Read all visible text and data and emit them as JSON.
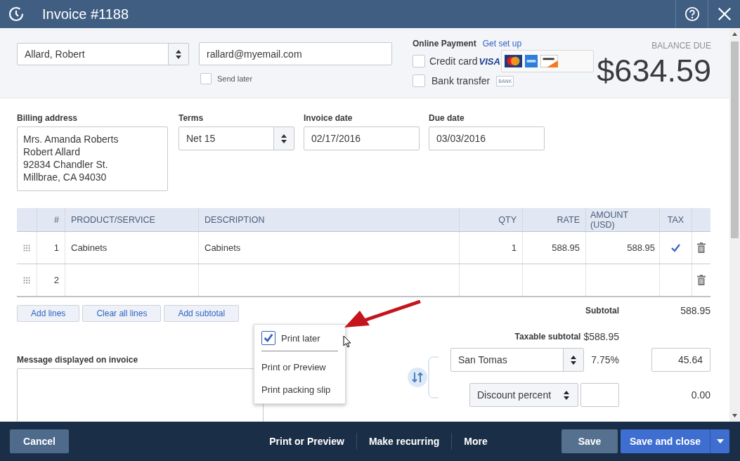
{
  "header": {
    "title": "Invoice #1188"
  },
  "customer": {
    "value": "Allard, Robert"
  },
  "email": {
    "value": "rallard@myemail.com"
  },
  "send_later": {
    "label": "Send later",
    "checked": false
  },
  "online_payment": {
    "title": "Online Payment",
    "link": "Get set up",
    "options": [
      {
        "kind": "card",
        "label": "Credit card",
        "checked": false,
        "badge": "VISA"
      },
      {
        "kind": "bank",
        "label": "Bank transfer",
        "checked": false,
        "badge": "BANK"
      }
    ]
  },
  "balance": {
    "label": "BALANCE DUE",
    "amount": "$634.59"
  },
  "billing_address": {
    "label": "Billing address",
    "lines": [
      "Mrs. Amanda Roberts",
      "Robert Allard",
      "92834 Chandler St.",
      "Millbrae, CA  94030"
    ]
  },
  "terms": {
    "label": "Terms",
    "value": "Net 15"
  },
  "invoice_date": {
    "label": "Invoice date",
    "value": "02/17/2016"
  },
  "due_date": {
    "label": "Due date",
    "value": "03/03/2016"
  },
  "table": {
    "columns": [
      "#",
      "PRODUCT/SERVICE",
      "DESCRIPTION",
      "QTY",
      "RATE",
      "AMOUNT (USD)",
      "TAX"
    ],
    "rows": [
      {
        "number": "1",
        "product": "Cabinets",
        "description": "Cabinets",
        "qty": "1",
        "rate": "588.95",
        "amount": "588.95",
        "taxable": true
      },
      {
        "number": "2",
        "taxable": false
      }
    ]
  },
  "line_buttons": [
    "Add lines",
    "Clear all lines",
    "Add subtotal"
  ],
  "message": {
    "label": "Message displayed on invoice"
  },
  "print_menu": {
    "items": [
      {
        "kind": "checkbox",
        "label": "Print later",
        "checked": true
      },
      {
        "kind": "action",
        "label": "Print or Preview"
      },
      {
        "kind": "action",
        "label": "Print packing slip"
      }
    ]
  },
  "totals": {
    "subtotal_label": "Subtotal",
    "subtotal": "588.95",
    "taxable_label": "Taxable subtotal",
    "taxable_value": "$588.95",
    "tax_select": "San Tomas",
    "tax_rate": "7.75%",
    "tax_amount": "45.64",
    "discount_select": "Discount percent",
    "discount_amount": "0.00"
  },
  "footer": {
    "cancel": "Cancel",
    "actions": [
      "Print or Preview",
      "Make recurring",
      "More"
    ],
    "save": "Save",
    "save_close": "Save and close"
  }
}
